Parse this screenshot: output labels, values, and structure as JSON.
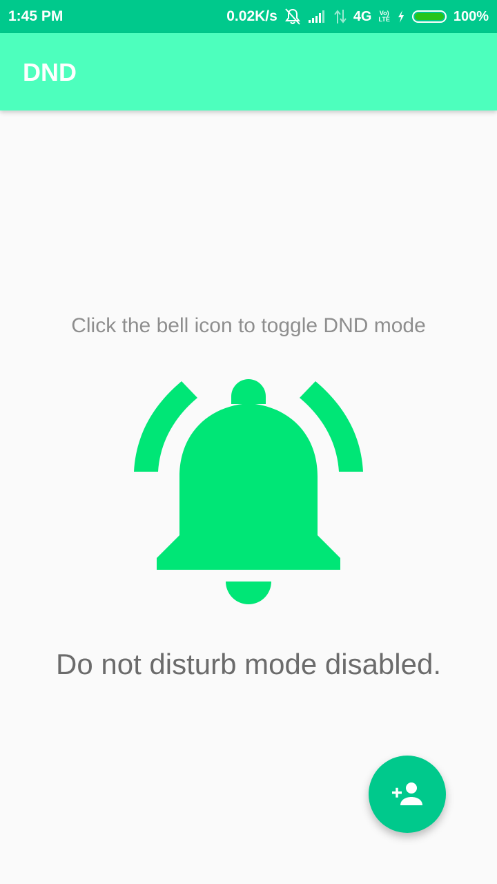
{
  "status_bar": {
    "time": "1:45 PM",
    "net_speed": "0.02K/s",
    "network_type": "4G",
    "volte_top": "Vo)",
    "volte_bottom": "LTE",
    "battery_percent": "100%",
    "battery_level": 1.0,
    "icons": [
      "notifications-off-icon",
      "signal-icon",
      "data-arrows-icon",
      "charging-icon",
      "battery-icon"
    ]
  },
  "app_bar": {
    "title": "DND"
  },
  "main": {
    "hint": "Click the bell icon to toggle DND mode",
    "bell_icon": "notifications-active-icon",
    "status": "Do not disturb mode disabled."
  },
  "fab": {
    "icon": "person-add-icon"
  },
  "colors": {
    "status_bar": "#00c98c",
    "app_bar": "#4dffbd",
    "bell": "#00e676",
    "fab": "#00c98c",
    "background": "#fafafa"
  }
}
